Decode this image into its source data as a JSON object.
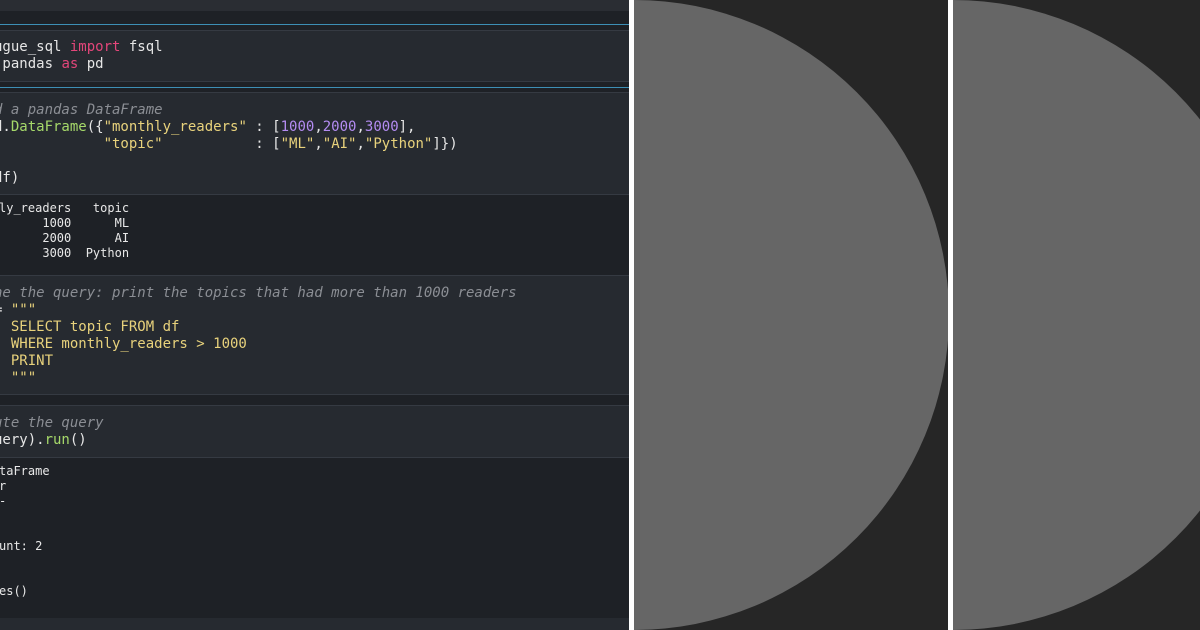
{
  "cells": [
    {
      "input": [
        [
          [
            "plain",
            "ugue_sql "
          ],
          [
            "kw",
            "import"
          ],
          [
            "plain",
            " fsql"
          ]
        ],
        [
          [
            "plain",
            " pandas "
          ],
          [
            "kw",
            "as"
          ],
          [
            "plain",
            " pd"
          ]
        ]
      ]
    },
    {
      "input": [
        [
          [
            "cm",
            "d a pandas DataFrame"
          ]
        ],
        [
          [
            "plain",
            "d."
          ],
          [
            "fn",
            "DataFrame"
          ],
          [
            "plain",
            "({"
          ],
          [
            "str",
            "\"monthly_readers\""
          ],
          [
            "plain",
            " : ["
          ],
          [
            "num",
            "1000"
          ],
          [
            "plain",
            ","
          ],
          [
            "num",
            "2000"
          ],
          [
            "plain",
            ","
          ],
          [
            "num",
            "3000"
          ],
          [
            "plain",
            "],"
          ]
        ],
        [
          [
            "plain",
            "             "
          ],
          [
            "str",
            "\"topic\""
          ],
          [
            "plain",
            "           : ["
          ],
          [
            "str",
            "\"ML\""
          ],
          [
            "plain",
            ","
          ],
          [
            "str",
            "\"AI\""
          ],
          [
            "plain",
            ","
          ],
          [
            "str",
            "\"Python\""
          ],
          [
            "plain",
            "]})"
          ]
        ],
        [
          [
            "plain",
            ""
          ]
        ],
        [
          [
            "plain",
            "df)"
          ]
        ]
      ],
      "output": [
        "ly_readers   topic",
        "      1000      ML",
        "      2000      AI",
        "      3000  Python"
      ]
    },
    {
      "input": [
        [
          [
            "cm",
            "ne the query: print the topics that had more than 1000 readers"
          ]
        ],
        [
          [
            "plain",
            "= "
          ],
          [
            "str",
            "\"\"\""
          ]
        ],
        [
          [
            "str",
            "  SELECT topic FROM df"
          ]
        ],
        [
          [
            "str",
            "  WHERE monthly_readers > 1000"
          ]
        ],
        [
          [
            "str",
            "  PRINT"
          ]
        ],
        [
          [
            "str",
            "  \"\"\""
          ]
        ]
      ]
    },
    {
      "input": [
        [
          [
            "cm",
            "ute the query"
          ]
        ],
        [
          [
            "plain",
            "uery)."
          ],
          [
            "fn",
            "run"
          ],
          [
            "plain",
            "()"
          ]
        ]
      ],
      "output": [
        "taFrame",
        "r",
        "-",
        "",
        "",
        "unt: 2",
        "",
        "",
        "es()"
      ]
    }
  ],
  "colors": {
    "notebook_bg": "#1e2126",
    "cell_bg": "#262a30",
    "keyword": "#e3467a",
    "function": "#a6d96a",
    "string": "#e8d27c",
    "number": "#b48cf2",
    "comment": "#8b8e94",
    "panel_bg": "#262626",
    "semicircle": "#666666"
  },
  "panels": [
    {
      "shape": "semicircle",
      "icon": "semicircle-shape"
    },
    {
      "shape": "semicircle",
      "icon": "semicircle-shape"
    }
  ]
}
